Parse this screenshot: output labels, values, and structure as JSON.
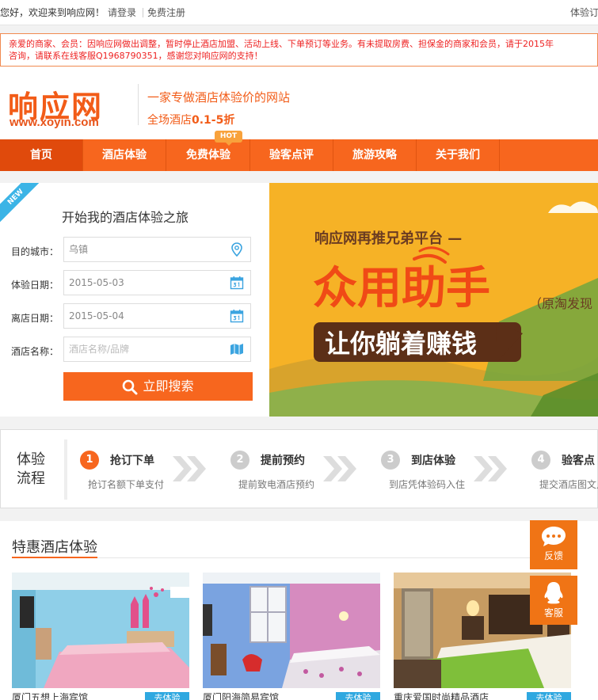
{
  "topbar": {
    "greeting": "您好，欢迎来到响应网！",
    "login": "请登录",
    "register": "免费注册",
    "right_link": "体验订"
  },
  "notice": {
    "line1": "亲爱的商家、会员：因响应网做出调整，暂时停止酒店加盟、活动上线、下单预订等业务。有未提取房费、担保金的商家和会员，请于2015年",
    "line2": "咨询，请联系在线客服Q1968790351，感谢您对响应网的支持！"
  },
  "header": {
    "logo_cn": "响应网",
    "logo_en": "www.xoyin.com",
    "slogan1": "一家专做酒店体验价的网站",
    "slogan2_prefix": "全场酒店",
    "slogan2_value": "0.1-5折"
  },
  "nav": {
    "items": [
      "首页",
      "酒店体验",
      "免费体验",
      "验客点评",
      "旅游攻略",
      "关于我们"
    ],
    "active": 0,
    "hot_badge": "HOT"
  },
  "search": {
    "ribbon": "NEW",
    "title": "开始我的酒店体验之旅",
    "city_label": "目的城市：",
    "city_value": "乌镇",
    "checkin_label": "体验日期：",
    "checkin_value": "2015-05-03",
    "checkout_label": "离店日期：",
    "checkout_value": "2015-05-04",
    "hotel_label": "酒店名称：",
    "hotel_placeholder": "酒店名称/品牌",
    "button": "立即搜索"
  },
  "banner": {
    "line1": "响应网再推兄弟平台 —",
    "brand": "众用助手",
    "sub": "（原淘发现",
    "slogan": "让你躺着赚钱"
  },
  "process": {
    "title": "体验\n流程",
    "steps": [
      {
        "num": "1",
        "title": "抢订下单",
        "desc": "抢订名额下单支付"
      },
      {
        "num": "2",
        "title": "提前预约",
        "desc": "提前致电酒店预约"
      },
      {
        "num": "3",
        "title": "到店体验",
        "desc": "到店凭体验码入住"
      },
      {
        "num": "4",
        "title": "验客点",
        "desc": "提交酒店图文点"
      }
    ]
  },
  "deals": {
    "title": "特惠酒店体验",
    "cards": [
      {
        "caption": "厦门五想上海宾馆",
        "tag": "去体验"
      },
      {
        "caption": "厦门阳海简易宾馆",
        "tag": "去体验"
      },
      {
        "caption": "重庆爱国时尚精品酒店",
        "tag": "去体验"
      }
    ]
  },
  "float": {
    "feedback": "反馈",
    "service": "客服"
  },
  "colors": {
    "brand_orange": "#f7661e",
    "nav_active": "#e04a0c",
    "notice_red": "#e22222",
    "tag_blue": "#2fa8e0"
  }
}
